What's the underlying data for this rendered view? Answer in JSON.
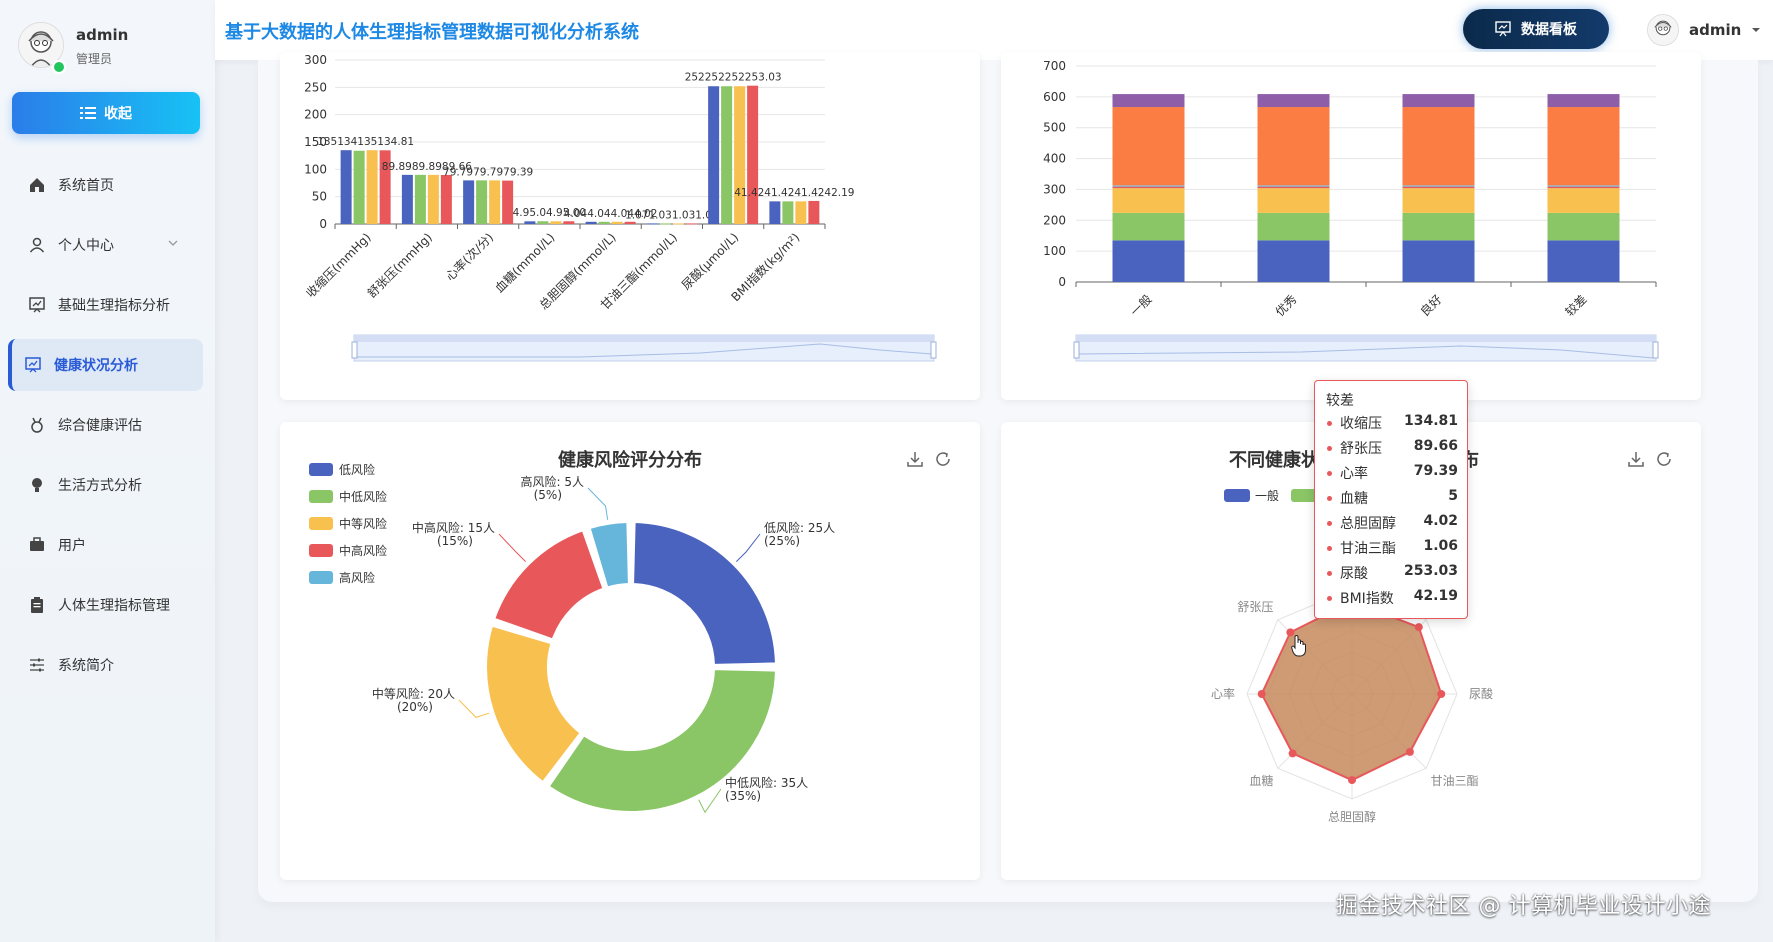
{
  "user": {
    "name": "admin",
    "role": "管理员"
  },
  "sidebar": {
    "collapse_label": "收起",
    "items": [
      {
        "label": "系统首页",
        "icon": "home-icon"
      },
      {
        "label": "个人中心",
        "icon": "person-icon"
      },
      {
        "label": "基础生理指标分析",
        "icon": "chart-board-icon"
      },
      {
        "label": "健康状况分析",
        "icon": "chart-board-icon",
        "active": true
      },
      {
        "label": "综合健康评估",
        "icon": "medal-icon"
      },
      {
        "label": "生活方式分析",
        "icon": "bulb-icon"
      },
      {
        "label": "用户",
        "icon": "briefcase-icon"
      },
      {
        "label": "人体生理指标管理",
        "icon": "clipboard-icon"
      },
      {
        "label": "系统简介",
        "icon": "sliders-icon"
      }
    ]
  },
  "header": {
    "title": "基于大数据的人体生理指标管理数据可视化分析系统",
    "board_button": "数据看板",
    "user_name": "admin"
  },
  "colors": {
    "blue": "#4a63bf",
    "green": "#8ac566",
    "yellow": "#f8c04f",
    "red": "#e8585b",
    "teal": "#66b6db",
    "orange": "#fb7d43",
    "purple": "#8e5fa8"
  },
  "chart_data": [
    {
      "type": "bar",
      "categories": [
        "收缩压(mmHg)",
        "舒张压(mmHg)",
        "心率(次/分)",
        "血糖(mmol/L)",
        "总胆固醇(mmol/L)",
        "甘油三酯(mmol/L)",
        "尿酸(μmol/L)",
        "BMI指数(kg/m²)"
      ],
      "series": [
        {
          "values": [
            135,
            89.89,
            79.79,
            4.9,
            4.04,
            1.07,
            252,
            41.42
          ]
        },
        {
          "values": [
            134,
            89.89,
            79.79,
            5.04,
            4.04,
            1.03,
            252,
            41.42
          ]
        },
        {
          "values": [
            135,
            89.89,
            79.79,
            4.9,
            4.04,
            1.03,
            252,
            41.42
          ]
        },
        {
          "values": [
            134.81,
            89.66,
            79.39,
            5.0,
            4.02,
            1.06,
            253.03,
            42.19
          ]
        }
      ],
      "data_labels": [
        "135134135134.81",
        "89.8989.8989.66",
        "79.7979.7979.39",
        "4.95.04.95.00",
        "4.044.044.044.02",
        "1.071.031.031.06",
        "252252252253.03",
        "41.4241.4241.4242.19"
      ],
      "yticks": [
        "0",
        "50",
        "100",
        "150",
        "200",
        "250",
        "300"
      ],
      "ylim": [
        0,
        300
      ]
    },
    {
      "type": "bar",
      "stacked": true,
      "categories": [
        "一般",
        "优秀",
        "良好",
        "较差"
      ],
      "series": [
        {
          "values": [
            135,
            135,
            135,
            135
          ]
        },
        {
          "values": [
            89,
            89,
            89,
            89
          ]
        },
        {
          "values": [
            80,
            80,
            80,
            80
          ]
        },
        {
          "values": [
            5,
            5,
            5,
            5
          ]
        },
        {
          "values": [
            4,
            4,
            4,
            4
          ]
        },
        {
          "values": [
            1,
            1,
            1,
            1
          ]
        },
        {
          "values": [
            253,
            253,
            253,
            253
          ]
        },
        {
          "values": [
            42,
            42,
            42,
            42
          ]
        }
      ],
      "yticks": [
        "0",
        "100",
        "200",
        "300",
        "400",
        "500",
        "600",
        "700"
      ],
      "ylim": [
        0,
        700
      ]
    },
    {
      "type": "pie",
      "title": "健康风险评分分布",
      "legend": [
        "低风险",
        "中低风险",
        "中等风险",
        "中高风险",
        "高风险"
      ],
      "slices": [
        {
          "name": "低风险",
          "value": 25,
          "label": "低风险: 25人",
          "pct": "(25%)"
        },
        {
          "name": "中低风险",
          "value": 35,
          "label": "中低风险: 35人",
          "pct": "(35%)"
        },
        {
          "name": "中等风险",
          "value": 20,
          "label": "中等风险: 20人",
          "pct": "(20%)"
        },
        {
          "name": "中高风险",
          "value": 15,
          "label": "中高风险: 15人",
          "pct": "(15%)"
        },
        {
          "name": "高风险",
          "value": 5,
          "label": "高风险: 5人",
          "pct": "(5%)"
        }
      ]
    },
    {
      "type": "radar",
      "title_left": "不同健康状",
      "title_right": "布",
      "legend": [
        "一般",
        "优秀",
        "良好",
        "较差"
      ],
      "legend_visible": [
        "一般",
        "差"
      ],
      "indicators": [
        "BMI指数",
        "尿酸",
        "甘油三酯",
        "总胆固醇",
        "血糖",
        "心率",
        "舒张压",
        "收缩压"
      ],
      "indicators_visible": {
        "BMI指数": "I指数"
      },
      "series": [
        {
          "name": "较差",
          "values": [
            0.9,
            0.85,
            0.78,
            0.82,
            0.8,
            0.86,
            0.83,
            0.88
          ]
        }
      ]
    }
  ],
  "tooltip": {
    "title": "较差",
    "rows": [
      {
        "label": "收缩压",
        "value": "134.81"
      },
      {
        "label": "舒张压",
        "value": "89.66"
      },
      {
        "label": "心率",
        "value": "79.39"
      },
      {
        "label": "血糖",
        "value": "5"
      },
      {
        "label": "总胆固醇",
        "value": "4.02"
      },
      {
        "label": "甘油三酯",
        "value": "1.06"
      },
      {
        "label": "尿酸",
        "value": "253.03"
      },
      {
        "label": "BMI指数",
        "value": "42.19"
      }
    ]
  },
  "watermark": "掘金技术社区 @ 计算机毕业设计小途"
}
